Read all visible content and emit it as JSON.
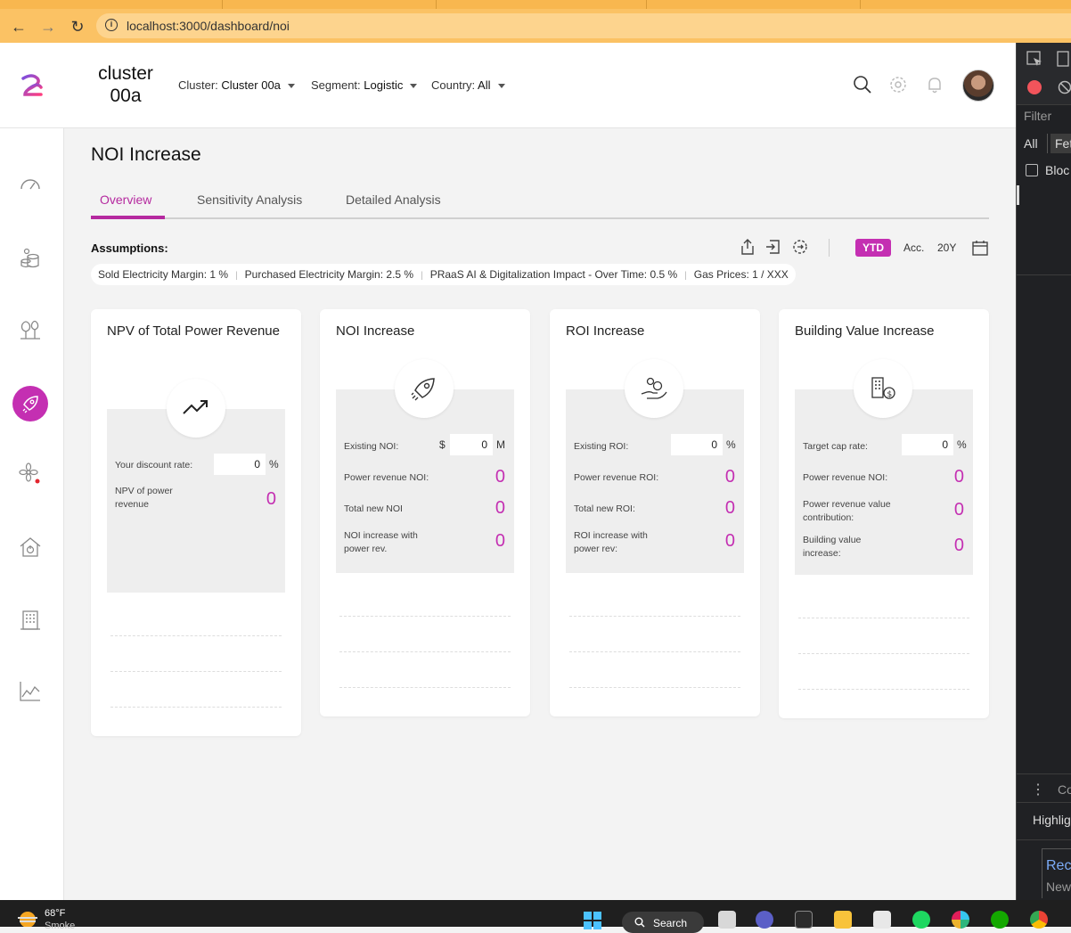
{
  "browser": {
    "url": "localhost:3000/dashboard/noi"
  },
  "header": {
    "cluster_title_line1": "cluster",
    "cluster_title_line2": "00a",
    "filters": [
      {
        "label": "Cluster:",
        "value": "Cluster 00a"
      },
      {
        "label": "Segment:",
        "value": "Logistic"
      },
      {
        "label": "Country:",
        "value": "All"
      }
    ]
  },
  "page": {
    "title": "NOI Increase",
    "tabs": [
      "Overview",
      "Sensitivity Analysis",
      "Detailed Analysis"
    ],
    "active_tab": "Overview"
  },
  "assumptions": {
    "label": "Assumptions:",
    "items": [
      "Sold Electricity Margin: 1 %",
      "Purchased Electricity Margin: 2.5 %",
      "PRaaS AI & Digitalization Impact - Over Time: 0.5 %",
      "Gas Prices: 1 / XXX"
    ]
  },
  "periods": {
    "active": "YTD",
    "acc": "Acc.",
    "twenty": "20Y"
  },
  "cards": [
    {
      "title": "NPV of Total Power Revenue",
      "icon": "trending-up-icon",
      "input": {
        "label": "Your discount rate:",
        "value": "0",
        "unit": "%",
        "prefix": ""
      },
      "rows": [
        {
          "label": "NPV of power revenue",
          "value": "0"
        }
      ]
    },
    {
      "title": "NOI Increase",
      "icon": "rocket-icon",
      "input": {
        "label": "Existing NOI:",
        "value": "0",
        "unit": "M",
        "prefix": "$"
      },
      "rows": [
        {
          "label": "Power revenue NOI:",
          "value": "0"
        },
        {
          "label": "Total new NOI",
          "value": "0"
        },
        {
          "label": "NOI increase with power rev.",
          "value": "0"
        }
      ]
    },
    {
      "title": "ROI Increase",
      "icon": "hand-coins-icon",
      "input": {
        "label": "Existing ROI:",
        "value": "0",
        "unit": "%",
        "prefix": ""
      },
      "rows": [
        {
          "label": "Power revenue ROI:",
          "value": "0"
        },
        {
          "label": "Total new ROI:",
          "value": "0"
        },
        {
          "label": "ROI increase with power rev:",
          "value": "0"
        }
      ]
    },
    {
      "title": "Building Value Increase",
      "icon": "building-dollar-icon",
      "input": {
        "label": "Target cap rate:",
        "value": "0",
        "unit": "%",
        "prefix": ""
      },
      "rows": [
        {
          "label": "Power revenue NOI:",
          "value": "0"
        },
        {
          "label": "Power revenue value contribution:",
          "value": "0"
        },
        {
          "label": "Building value increase:",
          "value": "0"
        }
      ]
    }
  ],
  "devtools": {
    "filter": "Filter",
    "all": "All",
    "fetch": "Fet",
    "block": "Bloc",
    "co": "Co",
    "highlight": "Highlig",
    "rec": "Rec",
    "new": "New"
  },
  "taskbar": {
    "temperature": "68°F",
    "condition": "Smoke",
    "search": "Search"
  },
  "colors": {
    "accent": "#c42fb2",
    "addressbar": "#fbc264"
  }
}
